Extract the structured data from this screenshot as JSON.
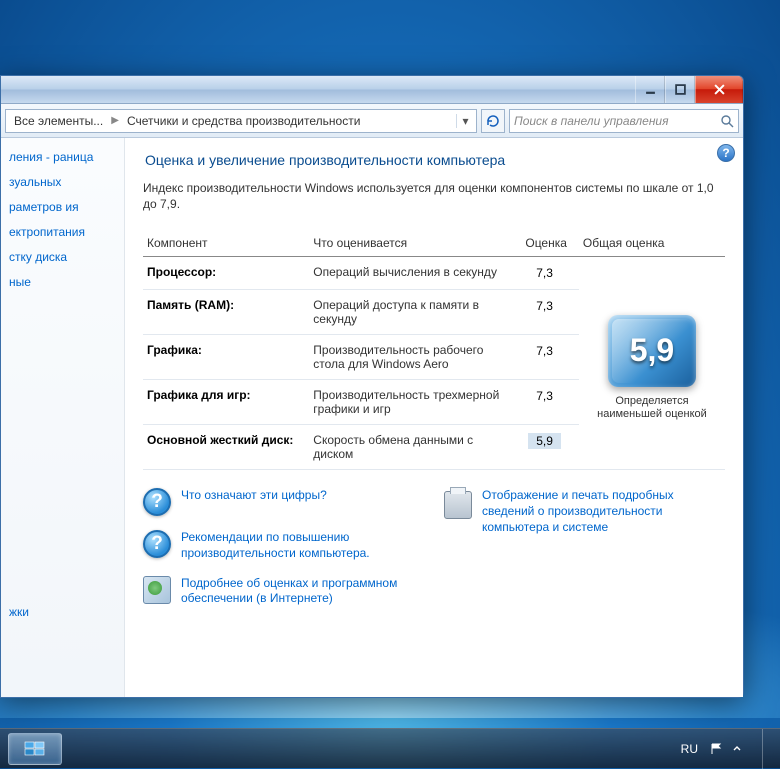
{
  "breadcrumb": {
    "item1": "Все элементы...",
    "item2": "Счетчики и средства производительности"
  },
  "search": {
    "placeholder": "Поиск в панели управления"
  },
  "sidebar": {
    "items": [
      "ления -\nраница",
      "зуальных",
      "раметров\nия",
      "ектропитания",
      "стку диска",
      "ные"
    ],
    "bottom": "жки"
  },
  "page": {
    "title": "Оценка и увеличение производительности компьютера",
    "intro": "Индекс производительности Windows используется для оценки компонентов системы по шкале от 1,0 до 7,9."
  },
  "table": {
    "headers": {
      "component": "Компонент",
      "desc": "Что оценивается",
      "score": "Оценка",
      "overall": "Общая оценка"
    },
    "rows": [
      {
        "name": "Процессор:",
        "desc": "Операций вычисления в секунду",
        "score": "7,3"
      },
      {
        "name": "Память (RAM):",
        "desc": "Операций доступа к памяти в секунду",
        "score": "7,3"
      },
      {
        "name": "Графика:",
        "desc": "Производительность рабочего стола для Windows Aero",
        "score": "7,3"
      },
      {
        "name": "Графика для игр:",
        "desc": "Производительность трехмерной графики и игр",
        "score": "7,3"
      },
      {
        "name": "Основной жесткий диск:",
        "desc": "Скорость обмена данными с диском",
        "score": "5,9"
      }
    ],
    "overall_score": "5,9",
    "overall_caption": "Определяется наименьшей оценкой"
  },
  "links": {
    "q1": "Что означают эти цифры?",
    "q2": "Рекомендации по повышению производительности компьютера.",
    "print": "Отображение и печать подробных сведений о производительности компьютера и системе",
    "software": "Подробнее об оценках и программном обеспечении (в Интернете)"
  },
  "taskbar": {
    "lang": "RU"
  }
}
